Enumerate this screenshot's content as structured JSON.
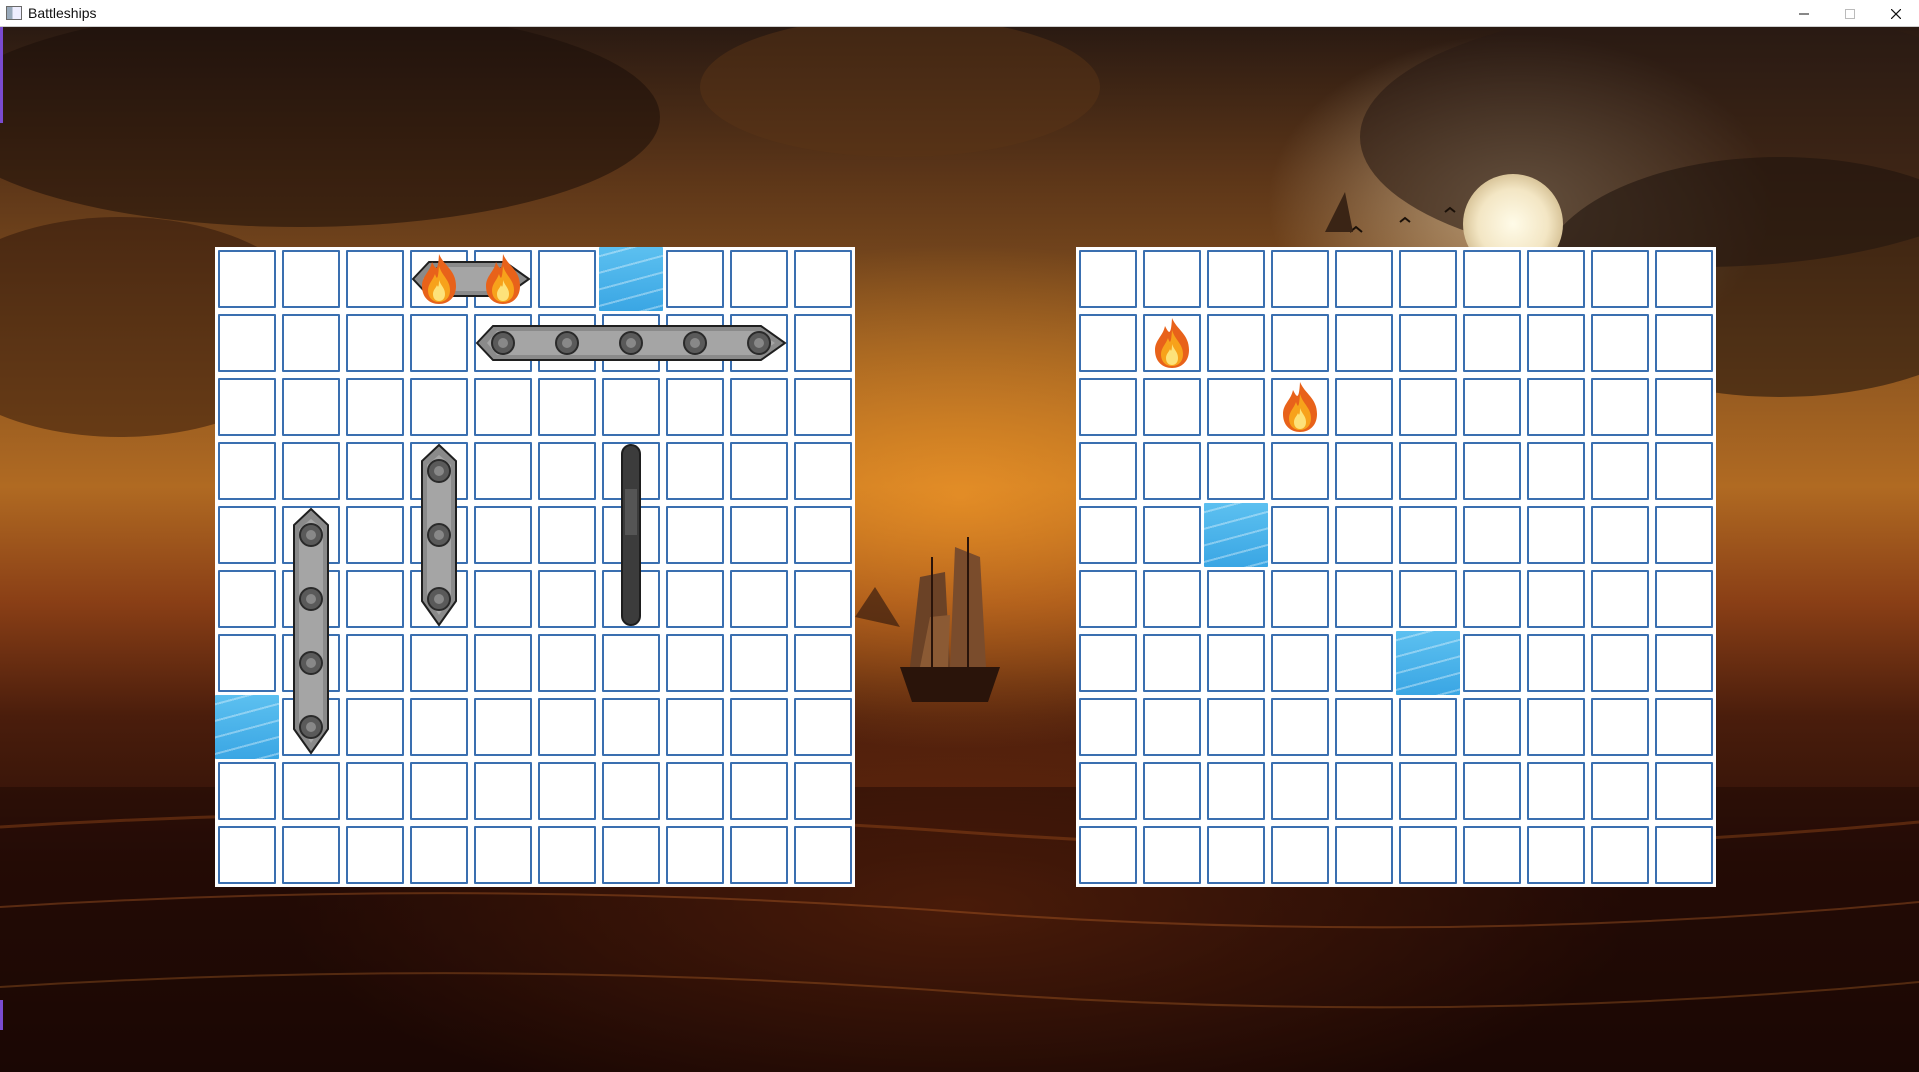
{
  "window": {
    "title": "Battleships",
    "controls": [
      "minimize",
      "maximize",
      "close"
    ]
  },
  "legend_icons": {
    "hit": "fire-icon",
    "miss": "water-icon",
    "empty": "empty-cell"
  },
  "player_board": {
    "rows": 10,
    "cols": 10,
    "misses": [
      [
        0,
        6
      ],
      [
        7,
        0
      ]
    ],
    "hits": [
      [
        0,
        3
      ],
      [
        0,
        4
      ]
    ],
    "ships": [
      {
        "name": "patrol-boat",
        "row": 0,
        "col": 3,
        "length": 2,
        "orientation": "horizontal"
      },
      {
        "name": "battleship",
        "row": 1,
        "col": 4,
        "length": 5,
        "orientation": "horizontal"
      },
      {
        "name": "cruiser",
        "row": 3,
        "col": 3,
        "length": 3,
        "orientation": "vertical"
      },
      {
        "name": "submarine",
        "row": 3,
        "col": 6,
        "length": 3,
        "orientation": "vertical"
      },
      {
        "name": "carrier",
        "row": 4,
        "col": 1,
        "length": 4,
        "orientation": "vertical"
      }
    ]
  },
  "enemy_board": {
    "rows": 10,
    "cols": 10,
    "misses": [
      [
        4,
        2
      ],
      [
        6,
        5
      ]
    ],
    "hits": [
      [
        1,
        1
      ],
      [
        2,
        3
      ]
    ]
  }
}
